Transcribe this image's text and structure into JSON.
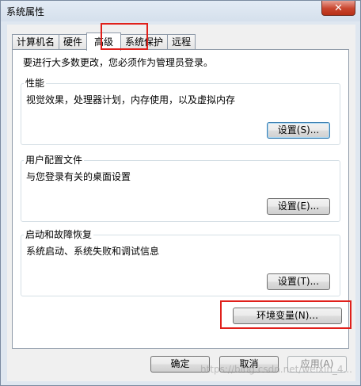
{
  "window": {
    "title": "系统属性",
    "close_label": "✕"
  },
  "tabs": [
    {
      "label": "计算机名"
    },
    {
      "label": "硬件"
    },
    {
      "label": "高级",
      "active": true
    },
    {
      "label": "系统保护"
    },
    {
      "label": "远程"
    }
  ],
  "advanced": {
    "admin_note": "要进行大多数更改，您必须作为管理员登录。",
    "performance": {
      "title": "性能",
      "description": "视觉效果，处理器计划，内存使用，以及虚拟内存",
      "button": "设置(S)..."
    },
    "user_profiles": {
      "title": "用户配置文件",
      "description": "与您登录有关的桌面设置",
      "button": "设置(E)..."
    },
    "startup_recovery": {
      "title": "启动和故障恢复",
      "description": "系统启动、系统失败和调试信息",
      "button": "设置(T)..."
    },
    "env_button": "环境变量(N)..."
  },
  "footer": {
    "ok": "确定",
    "cancel": "取消",
    "apply": "应用(A)"
  },
  "watermark": "https://blog.csdn.net/weixin_4..."
}
